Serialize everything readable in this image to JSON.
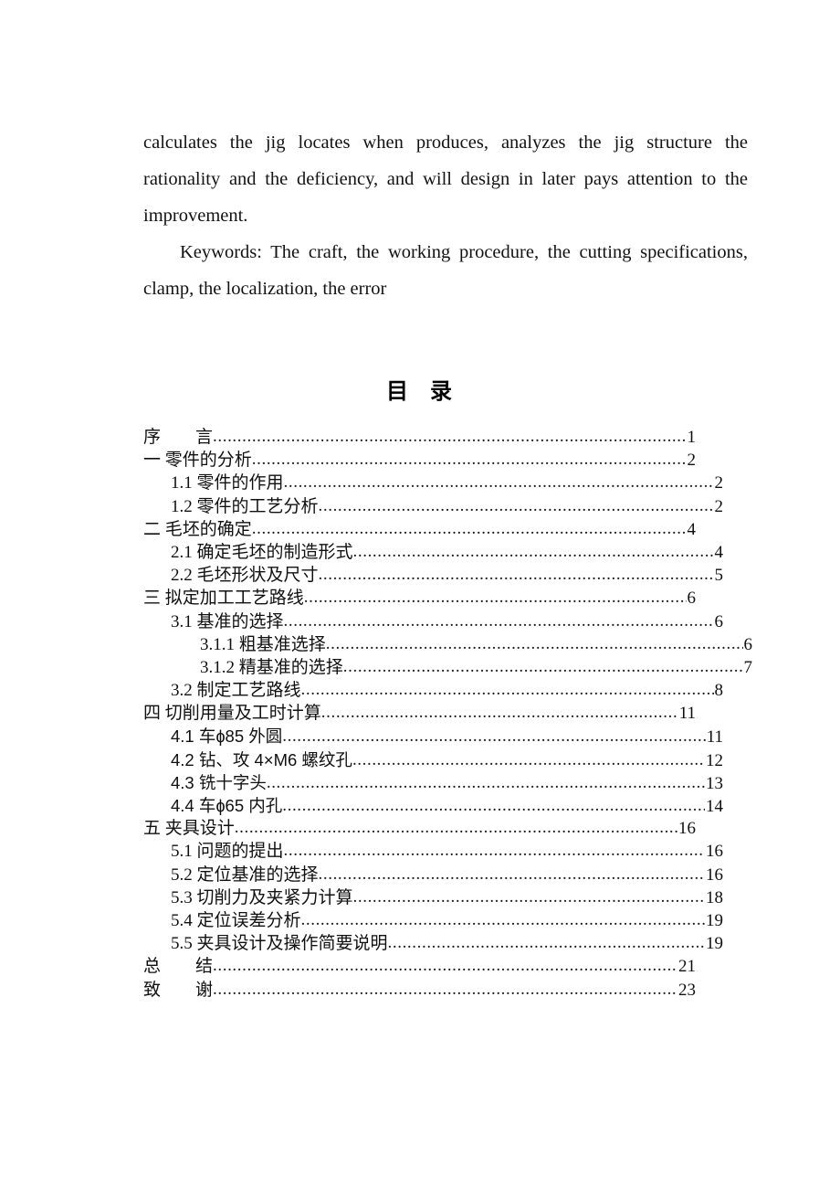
{
  "document": {
    "abstract": {
      "body_paragraph": "calculates the jig locates when produces, analyzes the jig structure the rationality and the deficiency, and will design in later pays attention to the improvement.",
      "keywords_paragraph": "Keywords: The craft, the working procedure, the cutting specifications, clamp, the localization, the error"
    },
    "toc": {
      "heading_left": "目",
      "heading_right": "录",
      "leader_char": ".",
      "entries": [
        {
          "label": "序　　言",
          "page": "1",
          "level": 0,
          "style": "normal"
        },
        {
          "label": "一 零件的分析",
          "page": "2",
          "level": 0,
          "style": "normal"
        },
        {
          "label": "1.1 零件的作用",
          "page": "2",
          "level": 1,
          "style": "normal"
        },
        {
          "label": "1.2  零件的工艺分析",
          "page": "2",
          "level": 1,
          "style": "normal"
        },
        {
          "label": "二 毛坯的确定",
          "page": "4",
          "level": 0,
          "style": "normal"
        },
        {
          "label": "2.1 确定毛坯的制造形式",
          "page": "4",
          "level": 1,
          "style": "normal"
        },
        {
          "label": "2.2 毛坯形状及尺寸",
          "page": "5",
          "level": 1,
          "style": "normal"
        },
        {
          "label": "三 拟定加工工艺路线",
          "page": "6",
          "level": 0,
          "style": "normal"
        },
        {
          "label": "3.1 基准的选择",
          "page": "6",
          "level": 1,
          "style": "normal"
        },
        {
          "label": "3.1.1 粗基准选择",
          "page": "6",
          "level": 2,
          "style": "normal"
        },
        {
          "label": "3.1.2  精基准的选择",
          "page": "7",
          "level": 2,
          "style": "normal"
        },
        {
          "label": "3.2 制定工艺路线",
          "page": "8",
          "level": 1,
          "style": "normal"
        },
        {
          "label": "四   切削用量及工时计算",
          "page": "11",
          "level": 0,
          "style": "normal"
        },
        {
          "label": "4.1  车ɸ85 外圆",
          "page": "11",
          "level": 1,
          "style": "alt"
        },
        {
          "label": "4.2 钻、攻 4×M6 螺纹孔",
          "page": "12",
          "level": 1,
          "style": "alt"
        },
        {
          "label": "4.3 铣十字头",
          "page": "13",
          "level": 1,
          "style": "alt"
        },
        {
          "label": "4.4 车ɸ65 内孔",
          "page": "14",
          "level": 1,
          "style": "alt"
        },
        {
          "label": "五 夹具设计",
          "page": "16",
          "level": 0,
          "style": "normal"
        },
        {
          "label": "5.1 问题的提出",
          "page": "16",
          "level": 1,
          "style": "normal"
        },
        {
          "label": "5.2 定位基准的选择",
          "page": "16",
          "level": 1,
          "style": "normal"
        },
        {
          "label": "5.3 切削力及夹紧力计算",
          "page": "18",
          "level": 1,
          "style": "normal"
        },
        {
          "label": "5.4 定位误差分析",
          "page": "19",
          "level": 1,
          "style": "normal"
        },
        {
          "label": "5.5 夹具设计及操作简要说明",
          "page": "19",
          "level": 1,
          "style": "normal"
        },
        {
          "label": "总　　结",
          "page": "21",
          "level": 0,
          "style": "normal"
        },
        {
          "label": "致　　谢",
          "page": "23",
          "level": 0,
          "style": "normal"
        }
      ]
    }
  }
}
